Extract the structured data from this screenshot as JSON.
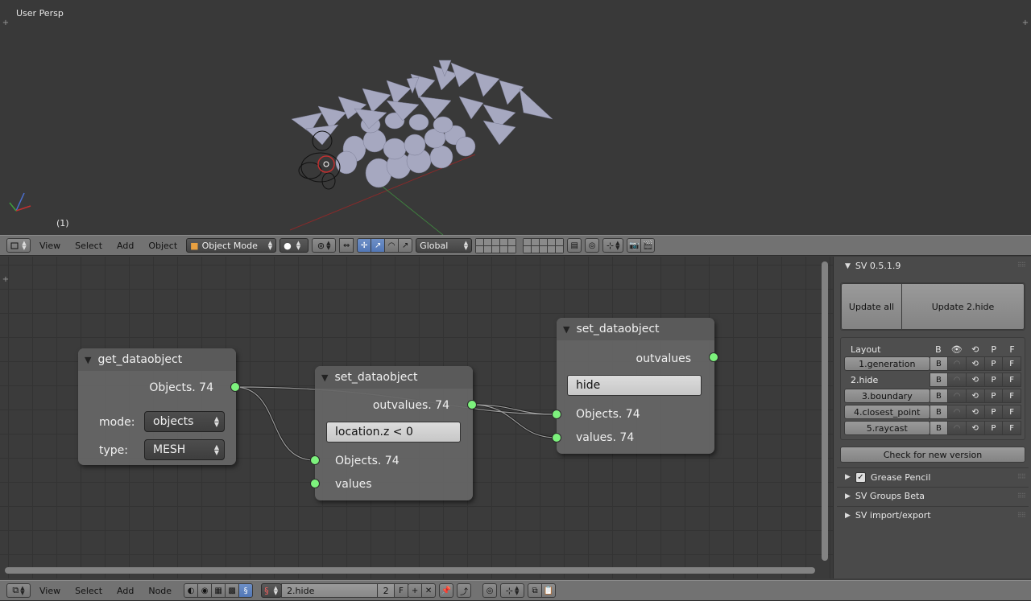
{
  "viewport": {
    "title": "User Persp",
    "frame": "(1)"
  },
  "view3d_header": {
    "menus": [
      "View",
      "Select",
      "Add",
      "Object"
    ],
    "mode": "Object Mode",
    "orientation": "Global"
  },
  "nodes": {
    "get": {
      "title": "get_dataobject",
      "output": "Objects. 74",
      "mode_label": "mode:",
      "mode_value": "objects",
      "type_label": "type:",
      "type_value": "MESH"
    },
    "set1": {
      "title": "set_dataobject",
      "output": "outvalues. 74",
      "expression": "location.z < 0",
      "input_objects": "Objects. 74",
      "input_values": "values"
    },
    "set2": {
      "title": "set_dataobject",
      "output": "outvalues",
      "expression": "hide",
      "input_objects": "Objects. 74",
      "input_values": "values. 74"
    }
  },
  "sidepanel": {
    "title": "SV 0.5.1.9",
    "update_all": "Update all",
    "update_current": "Update 2.hide",
    "layout_header": "Layout",
    "col_b": "B",
    "col_p": "P",
    "col_f": "F",
    "layouts": [
      {
        "name": "1.generation",
        "b": "B",
        "p": "P",
        "f": "F"
      },
      {
        "name": "2.hide",
        "b": "B",
        "p": "P",
        "f": "F"
      },
      {
        "name": "3.boundary",
        "b": "B",
        "p": "P",
        "f": "F"
      },
      {
        "name": "4.closest_point",
        "b": "B",
        "p": "P",
        "f": "F"
      },
      {
        "name": "5.raycast",
        "b": "B",
        "p": "P",
        "f": "F"
      }
    ],
    "check_version": "Check for new version",
    "sections": [
      "Grease Pencil",
      "SV Groups Beta",
      "SV import/export"
    ]
  },
  "node_header": {
    "menus": [
      "View",
      "Select",
      "Add",
      "Node"
    ],
    "tree_name": "2.hide",
    "users": "2",
    "fake_user": "F"
  }
}
